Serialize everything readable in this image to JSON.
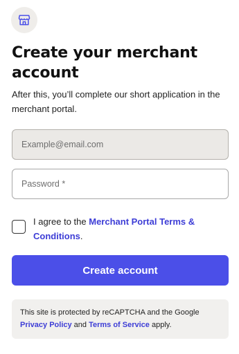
{
  "brand": {
    "icon": "storefront-icon"
  },
  "heading": {
    "title": "Create your merchant account"
  },
  "intro": {
    "text": "After this, you’ll complete our short application in the merchant portal."
  },
  "form": {
    "email_placeholder": "Example@email.com",
    "email_value": "",
    "password_placeholder": "Password *",
    "password_value": ""
  },
  "terms": {
    "checked": false,
    "prefix": "I agree to the ",
    "link_text": "Merchant Portal Terms & Conditions",
    "suffix": "."
  },
  "actions": {
    "create_label": "Create account"
  },
  "recaptcha": {
    "prefix": "This site is protected by reCAPTCHA and the Google ",
    "privacy_link": "Privacy Policy",
    "middle": " and ",
    "terms_link": "Terms of Service",
    "suffix": " apply."
  },
  "colors": {
    "accent": "#4b4fe8",
    "link": "#3d3dd6",
    "logo_bg": "#efedea",
    "notice_bg": "#f1f0ee"
  }
}
